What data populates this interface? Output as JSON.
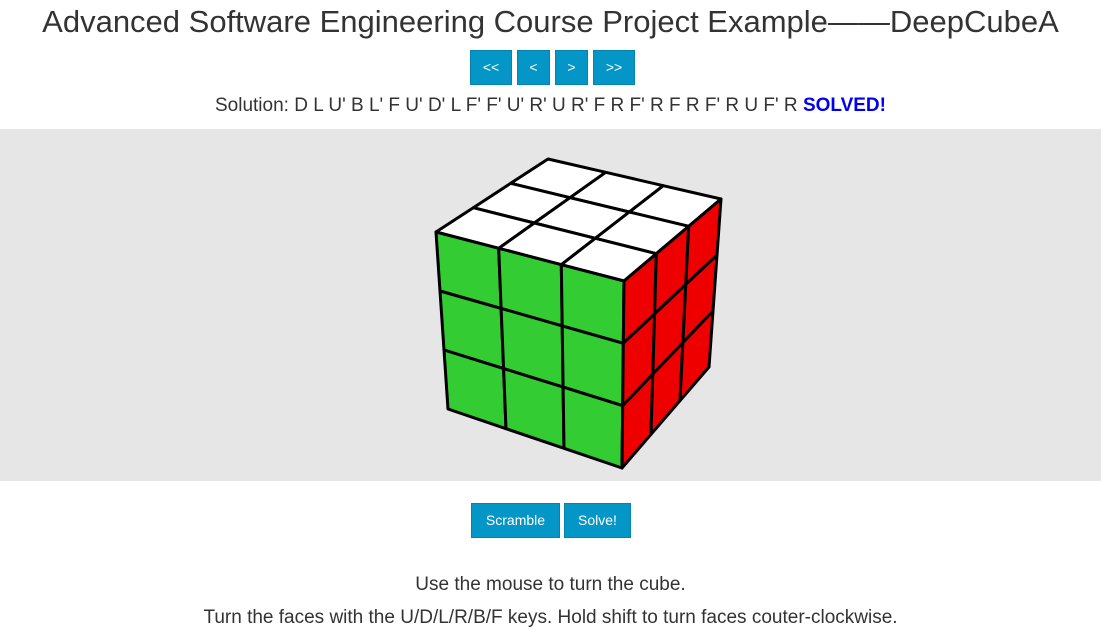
{
  "page": {
    "title": "Advanced Software Engineering Course Project Example——DeepCubeA"
  },
  "navigation": {
    "first_label": "<<",
    "prev_label": "<",
    "next_label": ">",
    "last_label": ">>"
  },
  "solution": {
    "label": "Solution:",
    "moves": "D L U' B L' F U' D' L F' F' U' R' U R' F R F' R F R F' R U F' R",
    "status": "SOLVED!"
  },
  "cube": {
    "top_color": "#ffffff",
    "front_color": "#33cc33",
    "right_color": "#ee0000",
    "edge_color": "#000000",
    "background_color": "#e6e6e6"
  },
  "actions": {
    "scramble_label": "Scramble",
    "solve_label": "Solve!"
  },
  "instructions": {
    "line1": "Use the mouse to turn the cube.",
    "line2": "Turn the faces with the U/D/L/R/B/F keys. Hold shift to turn faces couter-clockwise."
  },
  "colors": {
    "button_bg": "#0496c7",
    "button_text": "#ffffff",
    "solved_text": "#0000ee",
    "text": "#333333"
  }
}
